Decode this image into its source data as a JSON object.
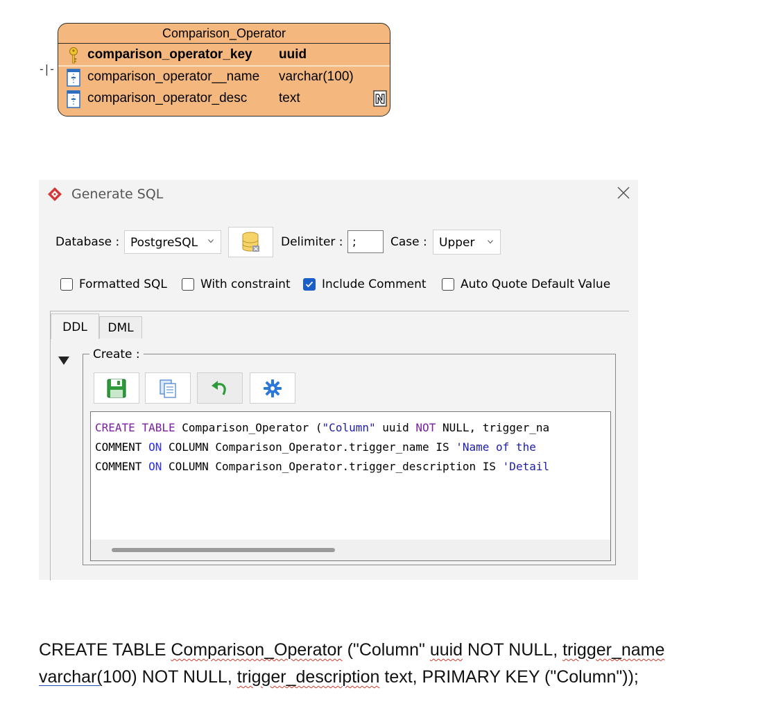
{
  "entity": {
    "name": "Comparison_Operator",
    "connector": "-|-",
    "columns": [
      {
        "name": "comparison_operator_key",
        "type": "uuid",
        "primary_key": true,
        "icon": "key-icon"
      },
      {
        "name": "comparison_operator__name",
        "type": "varchar(100)",
        "icon": "column-icon"
      },
      {
        "name": "comparison_operator_desc",
        "type": "text",
        "icon": "column-icon",
        "nullable_badge": "N"
      }
    ]
  },
  "dialog": {
    "title": "Generate SQL",
    "database_label": "Database :",
    "database_value": "PostgreSQL",
    "delimiter_label": "Delimiter :",
    "delimiter_value": ";",
    "case_label": "Case :",
    "case_value": "Upper",
    "options": [
      {
        "label": "Formatted SQL",
        "checked": false
      },
      {
        "label": "With constraint",
        "checked": false
      },
      {
        "label": "Include Comment",
        "checked": true
      },
      {
        "label": "Auto Quote Default Value",
        "checked": false
      }
    ],
    "tabs": [
      "DDL",
      "DML"
    ],
    "active_tab": "DDL",
    "create_label": "Create :",
    "toolbar": [
      "save-icon",
      "copy-icon",
      "undo-icon",
      "settings-icon"
    ],
    "code_lines": [
      "CREATE TABLE Comparison_Operator (\"Column\" uuid NOT NULL, trigger_na",
      "COMMENT ON COLUMN Comparison_Operator.trigger_name IS 'Name of the ",
      "COMMENT ON COLUMN Comparison_Operator.trigger_description IS 'Detail"
    ]
  },
  "document_text": {
    "line1_parts": [
      "CREATE TABLE ",
      "Comparison_Operator",
      " (\"Column\" ",
      "uuid",
      " NOT NULL, ",
      "trigger_name"
    ],
    "line2_parts": [
      "varchar(",
      "100) NOT NULL, ",
      "trigger_description",
      " text, PRIMARY KEY (\"Column\"));"
    ]
  },
  "colors": {
    "entity_fill": "#f4b87f",
    "accent_blue": "#1a5fc7",
    "keyword": "#7b1fa2",
    "string": "#1d1daa"
  }
}
